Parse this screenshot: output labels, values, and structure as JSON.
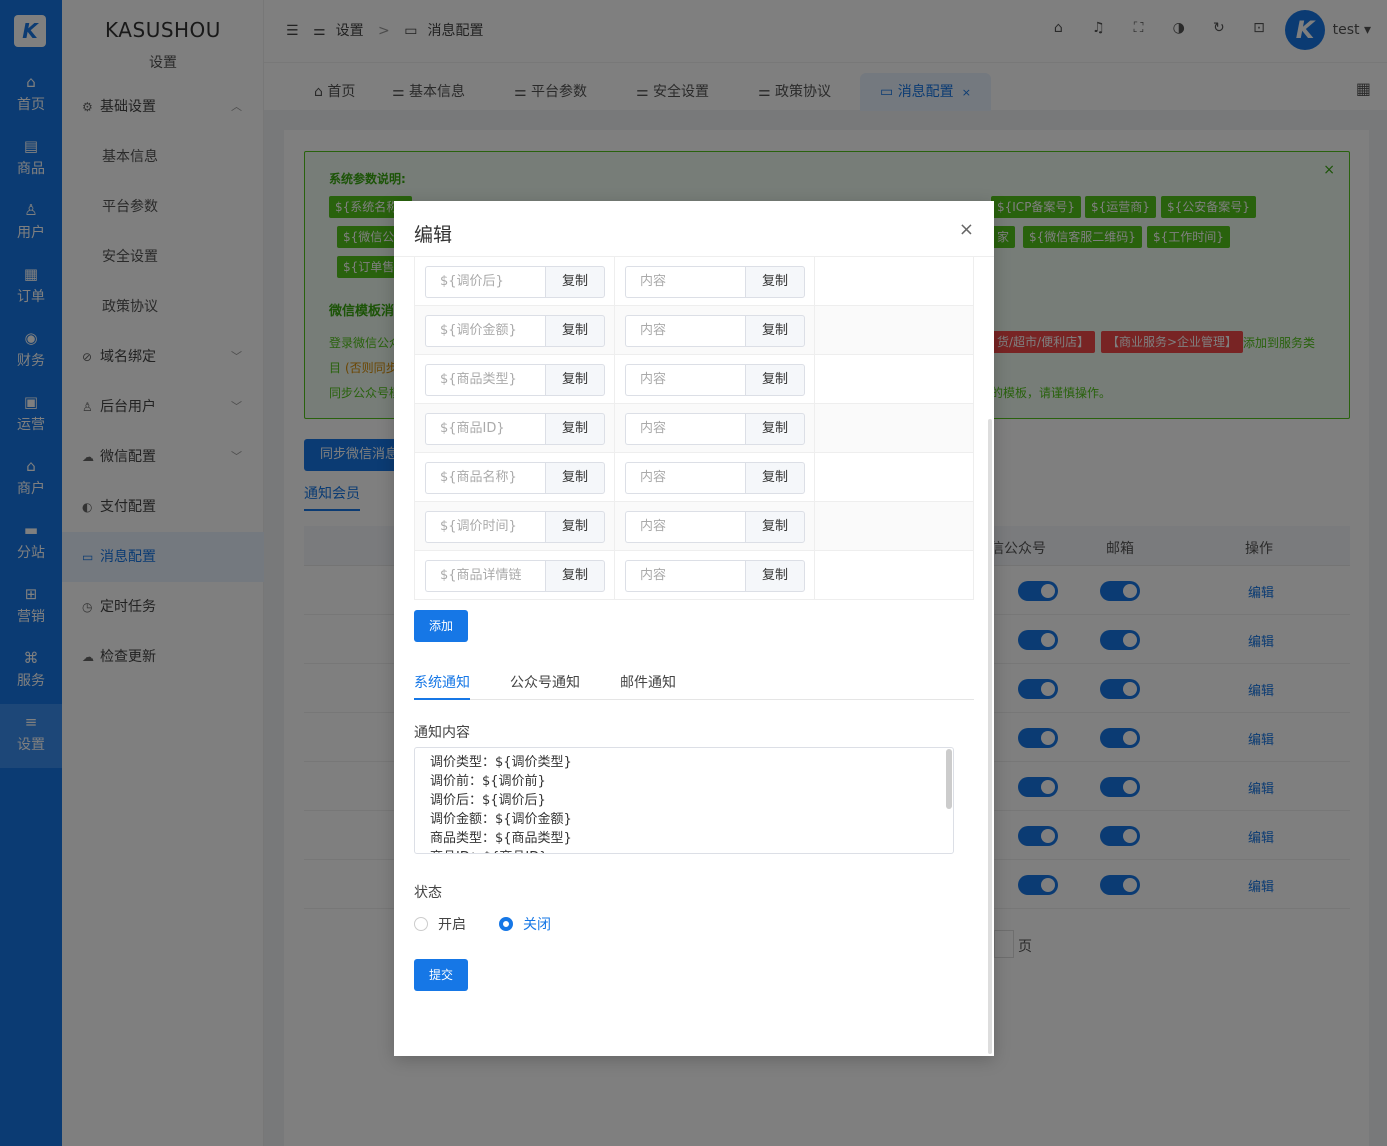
{
  "rail": {
    "logo": "K",
    "items": [
      {
        "label": "首页",
        "icon": "⌂"
      },
      {
        "label": "商品",
        "icon": "▤"
      },
      {
        "label": "用户",
        "icon": "♙"
      },
      {
        "label": "订单",
        "icon": "▦"
      },
      {
        "label": "财务",
        "icon": "◉"
      },
      {
        "label": "运营",
        "icon": "▣"
      },
      {
        "label": "商户",
        "icon": "⌂"
      },
      {
        "label": "分站",
        "icon": "▬"
      },
      {
        "label": "营销",
        "icon": "⊞"
      },
      {
        "label": "服务",
        "icon": "⌘"
      },
      {
        "label": "设置",
        "icon": "≡"
      }
    ]
  },
  "sidebar": {
    "title": "KASUSHOU",
    "subtitle": "设置",
    "items": [
      {
        "label": "基础设置",
        "icon": "⚙",
        "arrow": "︿"
      },
      {
        "label": "基本信息"
      },
      {
        "label": "平台参数"
      },
      {
        "label": "安全设置"
      },
      {
        "label": "政策协议"
      },
      {
        "label": "域名绑定",
        "icon": "⊘",
        "arrow": "﹀"
      },
      {
        "label": "后台用户",
        "icon": "♙",
        "arrow": "﹀"
      },
      {
        "label": "微信配置",
        "icon": "☁",
        "arrow": "﹀"
      },
      {
        "label": "支付配置",
        "icon": "◐"
      },
      {
        "label": "消息配置",
        "icon": "▭"
      },
      {
        "label": "定时任务",
        "icon": "◷"
      },
      {
        "label": "检查更新",
        "icon": "☁"
      }
    ]
  },
  "header": {
    "collapse_icon": "☰",
    "breadcrumb": [
      "设置",
      ">",
      "消息配置"
    ],
    "user": "test ▾",
    "avatar": "K"
  },
  "tabs": [
    {
      "label": "首页",
      "icon": "⌂"
    },
    {
      "label": "基本信息",
      "icon": "⚌"
    },
    {
      "label": "平台参数",
      "icon": "⚌"
    },
    {
      "label": "安全设置",
      "icon": "⚌"
    },
    {
      "label": "政策协议",
      "icon": "⚌"
    },
    {
      "label": "消息配置",
      "icon": "▭",
      "close": "×"
    }
  ],
  "notice": {
    "title": "系统参数说明:",
    "close": "×",
    "tags_row1": [
      "${系统名称}",
      "${ICP备案号}",
      "${运营商}",
      "${公安备案号}"
    ],
    "tags_row2": [
      "${微信公",
      "${微信客服二维码}",
      "${工作时间}"
    ],
    "tags_row3": [
      "${订单售"
    ],
    "wechat_title": "微信模板消",
    "line1_start": "登录微信公众",
    "tag_red1": "货/超市/便利店】",
    "tag_red2": "【商业服务>企业管理】",
    "line1_end": "添加到服务类",
    "line2_start": "目",
    "line2_orange": "(否则同步",
    "line3_start": "同步公众号模",
    "line3_end": "的模板，请谨慎操作。",
    "frag_tag": "家"
  },
  "main": {
    "sync_button": "同步微信消息",
    "sub_tab": "通知会员",
    "table_headers": [
      "信公众号",
      "邮箱",
      "操作"
    ],
    "edit_label": "编辑",
    "page_suffix": "页"
  },
  "modal": {
    "title": "编辑",
    "close": "×",
    "copy_label": "复制",
    "content_placeholder": "内容",
    "variables": [
      "${调价后}",
      "${调价金额}",
      "${商品类型}",
      "${商品ID}",
      "${商品名称}",
      "${调价时间}",
      "${商品详情链"
    ],
    "add_button": "添加",
    "notify_tabs": [
      "系统通知",
      "公众号通知",
      "邮件通知"
    ],
    "content_label": "通知内容",
    "content_lines": [
      "调价类型：${调价类型}",
      "调价前：${调价前}",
      "调价后：${调价后}",
      "调价金额：${调价金额}",
      "商品类型：${商品类型}",
      "商品ID：${商品ID}"
    ],
    "status_label": "状态",
    "status_on": "开启",
    "status_off": "关闭",
    "submit_button": "提交"
  }
}
